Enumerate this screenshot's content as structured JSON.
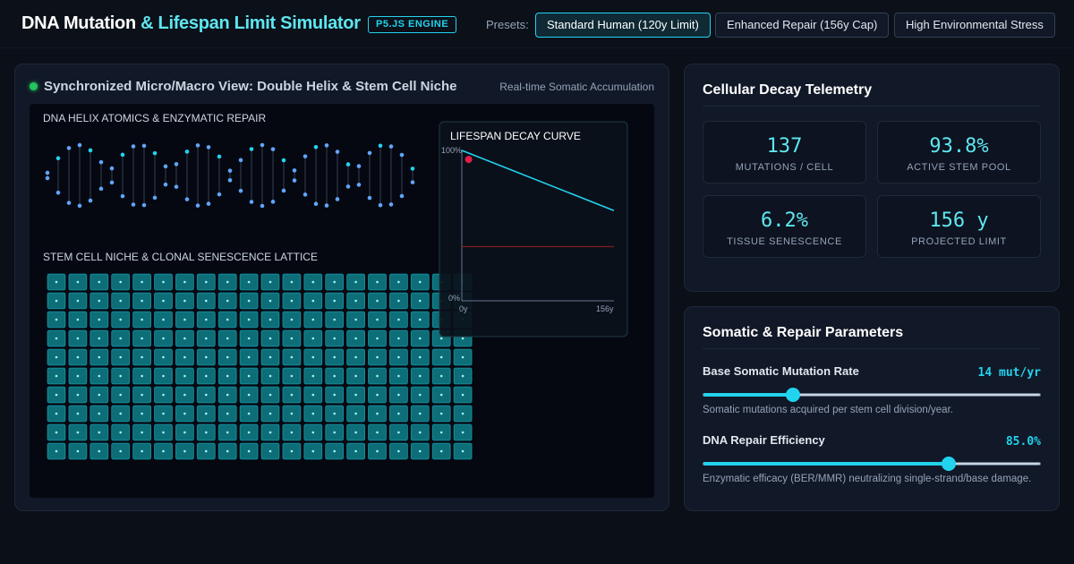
{
  "header": {
    "title_main": "DNA Mutation",
    "title_accent": "& Lifespan Limit Simulator",
    "engine_badge": "P5.JS ENGINE",
    "presets_label": "Presets:",
    "presets": [
      {
        "label": "Standard Human (120y Limit)",
        "active": true
      },
      {
        "label": "Enhanced Repair (156y Cap)",
        "active": false
      },
      {
        "label": "High Environmental Stress",
        "active": false
      }
    ]
  },
  "viewer": {
    "title": "Synchronized Micro/Macro View: Double Helix & Stem Cell Niche",
    "subtitle": "Real-time Somatic Accumulation",
    "helix_label": "DNA HELIX ATOMICS & ENZYMATIC REPAIR",
    "lattice_label": "STEM CELL NICHE & CLONAL SENESCENCE LATTICE",
    "curve": {
      "title": "LIFESPAN DECAY CURVE",
      "y_top": "100%",
      "y_bottom": "0%",
      "x_start": "0y",
      "x_end": "156y",
      "current_point": {
        "years": 7,
        "percent": 94
      },
      "end_point": {
        "years": 156,
        "percent": 60
      },
      "threshold_percent": 36
    }
  },
  "telemetry": {
    "title": "Cellular Decay Telemetry",
    "stats": [
      {
        "value": "137",
        "label": "MUTATIONS / CELL"
      },
      {
        "value": "93.8%",
        "label": "ACTIVE STEM POOL"
      },
      {
        "value": "6.2%",
        "label": "TISSUE SENESCENCE"
      },
      {
        "value": "156 y",
        "label": "PROJECTED LIMIT"
      }
    ]
  },
  "parameters": {
    "title": "Somatic & Repair Parameters",
    "items": [
      {
        "label": "Base Somatic Mutation Rate",
        "value": "14 mut/yr",
        "level": 0.265,
        "desc": "Somatic mutations acquired per stem cell division/year."
      },
      {
        "label": "DNA Repair Efficiency",
        "value": "85.0%",
        "level": 0.73,
        "desc": "Enzymatic efficacy (BER/MMR) neutralizing single-strand/base damage."
      }
    ]
  },
  "colors": {
    "accent": "#22d3ee",
    "live": "#22c55e",
    "marker": "#e11d48",
    "cell_fill": "#0d6e77"
  }
}
